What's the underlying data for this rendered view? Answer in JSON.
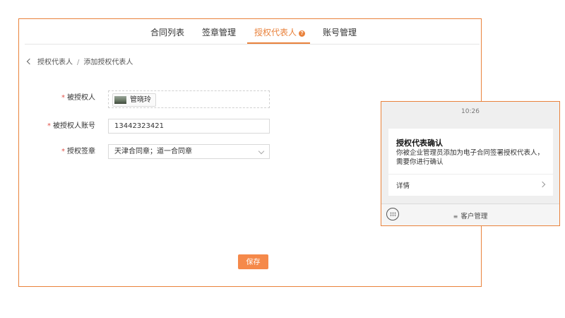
{
  "tabs": [
    {
      "label": "合同列表",
      "active": false
    },
    {
      "label": "签章管理",
      "active": false
    },
    {
      "label": "授权代表人",
      "active": true,
      "badge": "?"
    },
    {
      "label": "账号管理",
      "active": false
    }
  ],
  "breadcrumb": {
    "parent": "授权代表人",
    "separator": "/",
    "current": "添加授权代表人"
  },
  "form": {
    "required_mark": "*",
    "grantee_label": "被授权人",
    "grantee_name": "管晓玲",
    "account_label": "被授权人账号",
    "account_value": "13442323421",
    "seal_label": "授权签章",
    "seal_value": "天津合同章；道一合同章",
    "save_label": "保存"
  },
  "phone": {
    "time": "10:26",
    "card_title": "授权代表确认",
    "card_body": "你被企业管理员添加为电子合同签署授权代表人，需要你进行确认",
    "detail_label": "详情",
    "menu_icon": "≡",
    "menu_label": "客户管理"
  },
  "colors": {
    "accent": "#e9823c",
    "button": "#f5894a",
    "required": "#e0534a"
  },
  "icons": [
    "back-chevron-icon",
    "help-icon",
    "avatar",
    "chevron-down-icon",
    "chevron-right-icon",
    "keyboard-icon",
    "menu-lines-icon"
  ]
}
